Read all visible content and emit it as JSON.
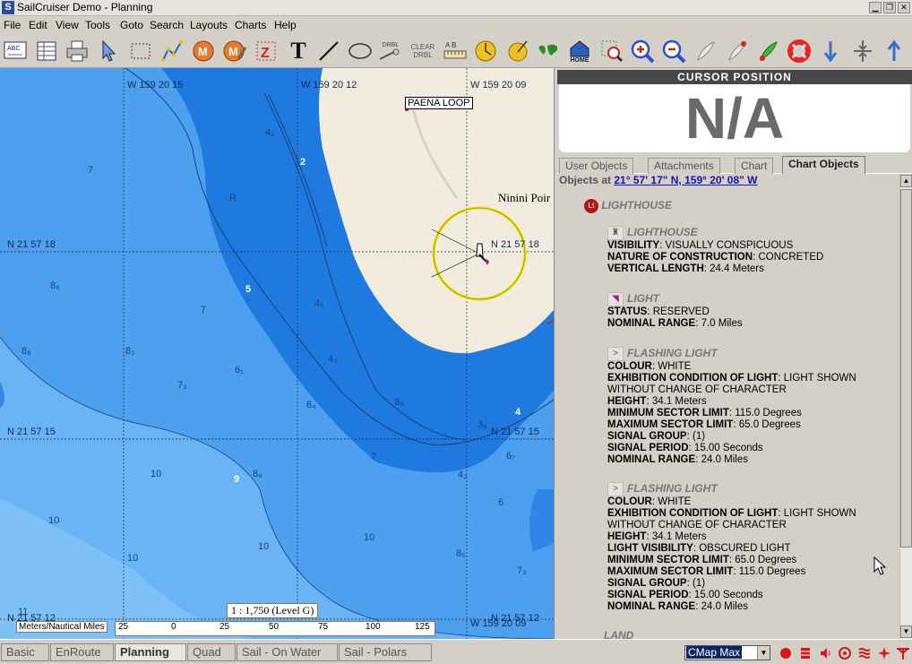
{
  "window": {
    "title": "SailCruiser Demo - Planning"
  },
  "menu": [
    "File",
    "Edit",
    "View",
    "Tools",
    "Goto",
    "Search",
    "Layouts",
    "Charts",
    "Help"
  ],
  "toolbar": {
    "drbl": "DRBL",
    "clear_drbl_1": "CLEAR",
    "clear_drbl_2": "DRBL",
    "text_tool": "T",
    "home": "HOME"
  },
  "chart": {
    "lon_labels": [
      "W 159 20 15",
      "W 159 20 12",
      "W 159 20 09",
      "W 159 20 09"
    ],
    "lat_labels": [
      "N 21 57 18",
      "N 21 57 18",
      "N 21 57 15",
      "N 21 57 15",
      "N 21 57 12",
      "N 21 57 12"
    ],
    "place_paena": "PAENA LOOP",
    "place_ninini": "Ninini Poir",
    "scale_text": "1 : 1,750 (Level G)",
    "scalebar_unit": "Meters/Nautical Miles",
    "scalebar_ticks": [
      "25",
      "0",
      "25",
      "50",
      "75",
      "100",
      "125"
    ],
    "depths": [
      "7",
      "4₂",
      "R",
      "8₈",
      "7",
      "4₅",
      "8₈",
      "8₂",
      "6₁",
      "7₃",
      "4₅",
      "6₄",
      "3₆",
      "3₆",
      "6₇",
      "4₂",
      "7",
      "10",
      "8₈",
      "6",
      "10",
      "10",
      "10",
      "8₅",
      "7₃",
      "10",
      "11"
    ],
    "contour_labels": [
      "2",
      "5",
      "4",
      "9"
    ]
  },
  "panel": {
    "cursor_header": "CURSOR POSITION",
    "cursor_value": "N/A",
    "tabs": [
      "User Objects",
      "Attachments",
      "Chart",
      "Chart Objects"
    ],
    "objects_at_label": "Objects at",
    "objects_at_link": "21° 57' 17\" N, 159° 20' 08\" W",
    "group_title": "LIGHTHOUSE",
    "lt_badge": "Lt",
    "lighthouse": {
      "title": "LIGHTHOUSE",
      "props": [
        {
          "k": "VISIBILITY",
          "v": "VISUALLY CONSPICUOUS"
        },
        {
          "k": "NATURE OF CONSTRUCTION",
          "v": "CONCRETED"
        },
        {
          "k": "VERTICAL LENGTH",
          "v": "24.4 Meters"
        }
      ]
    },
    "light": {
      "title": "LIGHT",
      "props": [
        {
          "k": "STATUS",
          "v": "RESERVED"
        },
        {
          "k": "NOMINAL RANGE",
          "v": "7.0 Miles"
        }
      ]
    },
    "flash1": {
      "title": "FLASHING LIGHT",
      "props": [
        {
          "k": "COLOUR",
          "v": "WHITE"
        },
        {
          "k": "EXHIBITION CONDITION OF LIGHT",
          "v": "LIGHT SHOWN"
        },
        {
          "k": "",
          "v": "WITHOUT CHANGE OF CHARACTER"
        },
        {
          "k": "HEIGHT",
          "v": "34.1 Meters"
        },
        {
          "k": "MINIMUM SECTOR LIMIT",
          "v": "115.0 Degrees"
        },
        {
          "k": "MAXIMUM SECTOR LIMIT",
          "v": "65.0 Degrees"
        },
        {
          "k": "SIGNAL GROUP",
          "v": "(1)"
        },
        {
          "k": "SIGNAL PERIOD",
          "v": "15.00 Seconds"
        },
        {
          "k": "NOMINAL RANGE",
          "v": "24.0 Miles"
        }
      ]
    },
    "flash2": {
      "title": "FLASHING LIGHT",
      "props": [
        {
          "k": "COLOUR",
          "v": "WHITE"
        },
        {
          "k": "EXHIBITION CONDITION OF LIGHT",
          "v": "LIGHT SHOWN"
        },
        {
          "k": "",
          "v": "WITHOUT CHANGE OF CHARACTER"
        },
        {
          "k": "HEIGHT",
          "v": "34.1 Meters"
        },
        {
          "k": "LIGHT VISIBILITY",
          "v": "OBSCURED LIGHT"
        },
        {
          "k": "MINIMUM SECTOR LIMIT",
          "v": "65.0 Degrees"
        },
        {
          "k": "MAXIMUM SECTOR LIMIT",
          "v": "115.0 Degrees"
        },
        {
          "k": "SIGNAL GROUP",
          "v": "(1)"
        },
        {
          "k": "SIGNAL PERIOD",
          "v": "15.00 Seconds"
        },
        {
          "k": "NOMINAL RANGE",
          "v": "24.0 Miles"
        }
      ]
    },
    "next_group": "LAND"
  },
  "status": {
    "tabs": [
      "Basic",
      "EnRoute",
      "Planning",
      "Quad",
      "Sail - On Water",
      "Sail - Polars"
    ],
    "active_tab": "Planning",
    "chart_source": "CMap Max"
  }
}
